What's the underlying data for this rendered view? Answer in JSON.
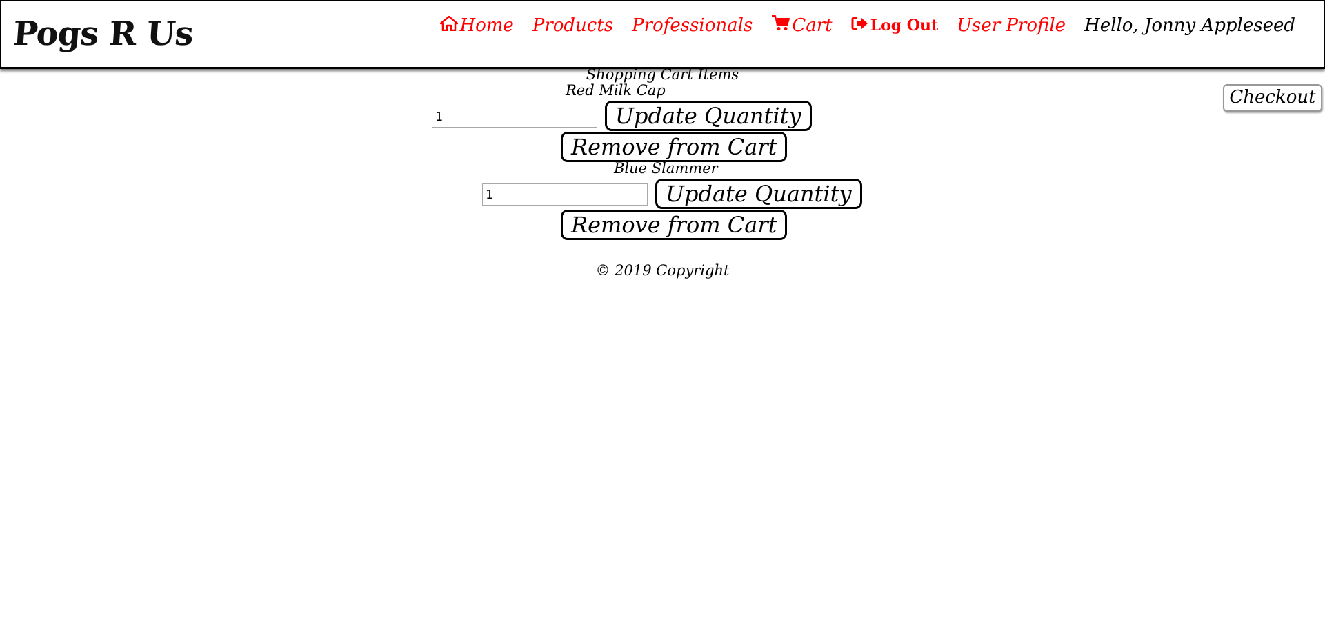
{
  "brand": {
    "logo_text": "Pogs R Us"
  },
  "nav": {
    "home": "Home",
    "products": "Products",
    "professionals": "Professionals",
    "cart": "Cart",
    "logout": "Log Out",
    "user_profile": "User Profile",
    "greeting": "Hello, Jonny Appleseed"
  },
  "cart": {
    "title": "Shopping Cart Items",
    "checkout_label": "Checkout",
    "items": [
      {
        "name": "Red Milk Cap",
        "quantity": "1",
        "update_label": "Update Quantity",
        "remove_label": "Remove from Cart"
      },
      {
        "name": "Blue Slammer",
        "quantity": "1",
        "update_label": "Update Quantity",
        "remove_label": "Remove from Cart"
      }
    ]
  },
  "footer": {
    "copyright": "© 2019 Copyright"
  },
  "colors": {
    "nav_link": "#ff0000",
    "text": "#000000",
    "background": "#ffffff"
  },
  "icons": {
    "home": "home-icon",
    "cart": "cart-icon",
    "logout": "logout-icon"
  }
}
